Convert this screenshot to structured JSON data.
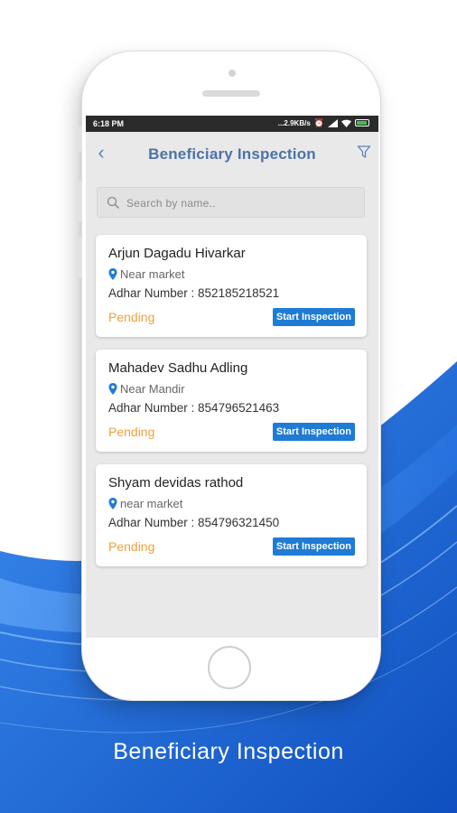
{
  "caption": "Beneficiary Inspection",
  "status_bar": {
    "time": "6:18 PM",
    "network": "...2.9KB/s",
    "icons": [
      "alarm-icon",
      "signal-icon",
      "wifi-icon",
      "battery-icon"
    ]
  },
  "app_bar": {
    "title": "Beneficiary Inspection",
    "back_icon": "chevron-left-icon",
    "filter_icon": "filter-icon"
  },
  "search": {
    "placeholder": "Search by name.."
  },
  "beneficiaries": [
    {
      "name": "Arjun Dagadu Hivarkar",
      "location": "Near market",
      "adhar": "Adhar Number : 852185218521",
      "status": "Pending",
      "action": "Start Inspection"
    },
    {
      "name": "Mahadev Sadhu Adling",
      "location": "Near Mandir",
      "adhar": "Adhar Number : 854796521463",
      "status": "Pending",
      "action": "Start Inspection"
    },
    {
      "name": "Shyam devidas rathod",
      "location": "near market",
      "adhar": "Adhar Number : 854796321450",
      "status": "Pending",
      "action": "Start Inspection"
    }
  ],
  "colors": {
    "title": "#4d72a6",
    "pending": "#f2a03a",
    "button": "#1e7bd6",
    "background_wave": "#1f6fd8"
  }
}
